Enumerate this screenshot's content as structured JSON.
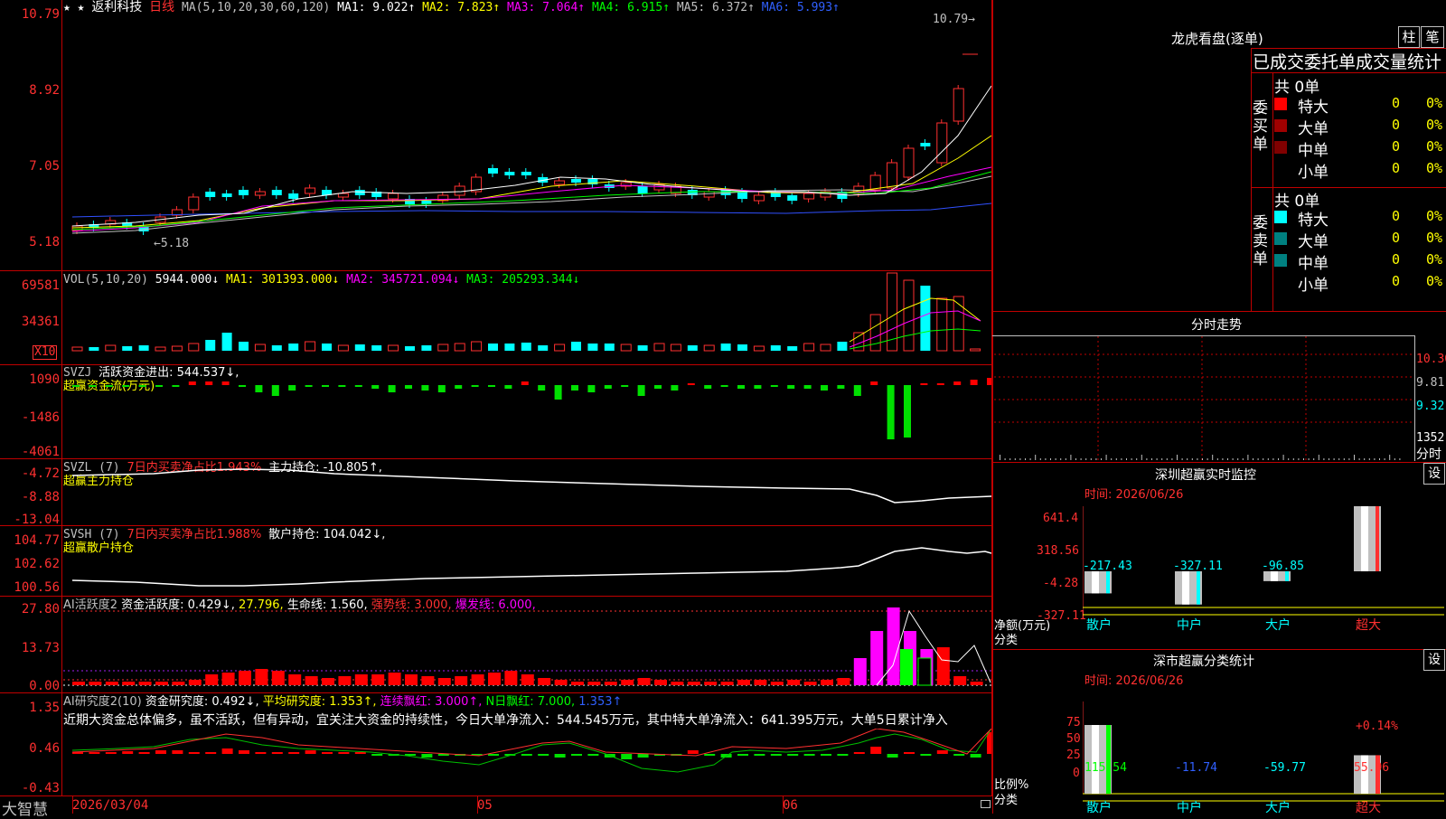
{
  "title_bar": {
    "stars": "★ ★",
    "stock": "返利科技",
    "period": "日线",
    "ma_label": "MA(5,10,20,30,60,120)",
    "ma1": "MA1: 9.022↑",
    "ma2": "MA2: 7.823↑",
    "ma3": "MA3: 7.064↑",
    "ma4": "MA4: 6.915↑",
    "ma5": "MA5: 6.372↑",
    "ma6": "MA6: 5.993↑"
  },
  "price_panel": {
    "axis": [
      "10.79",
      "8.92",
      "7.05",
      "5.18"
    ],
    "high_label": "10.79→",
    "low_label": "←5.18"
  },
  "vol_panel": {
    "label": "VOL(5,10,20)",
    "value": "5944.000↓",
    "ma1": "MA1: 301393.000↓",
    "ma2": "MA2: 345721.094↓",
    "ma3": "MA3: 205293.344↓",
    "axis": [
      "69581",
      "34361"
    ],
    "unit": "X10"
  },
  "svzj_panel": {
    "label": "SVZJ",
    "desc": "活跃资金进出: 544.537↓,",
    "name": "超赢资金流(万元)",
    "axis": [
      "1090",
      "-1486",
      "-4061"
    ]
  },
  "svzl_panel": {
    "label": "SVZL (7)",
    "desc1": "7日内买卖净占比1.943%",
    "desc2": "主力持仓: -10.805↑,",
    "name": "超赢主力持仓",
    "axis": [
      "-4.72",
      "-8.88",
      "-13.04"
    ]
  },
  "svsh_panel": {
    "label": "SVSH (7)",
    "desc1": "7日内买卖净占比1.988%",
    "desc2": "散户持仓: 104.042↓,",
    "name": "超赢散户持仓",
    "axis": [
      "104.77",
      "102.62",
      "100.56"
    ]
  },
  "ai_active": {
    "label": "AI活跃度2",
    "d1": "资金活跃度: 0.429↓,",
    "d2": "27.796,",
    "d3": "生命线: 1.560,",
    "d4": "强势线: 3.000,",
    "d5": "爆发线: 6.000,",
    "axis": [
      "27.80",
      "13.73",
      "0.00"
    ]
  },
  "ai_research": {
    "label": "AI研究度2(10)",
    "d1": "资金研究度: 0.492↓,",
    "d2": "平均研究度: 1.353↑,",
    "d3": "连续飘红: 3.000↑,",
    "d4": "N日飘红: 7.000,",
    "d5": "1.353↑",
    "comment": "近期大资金总体偏多，虽不活跃，但有异动，宜关注大资金的持续性，今日大单净流入：544.545万元，其中特大单净流入：641.395万元，大单5日累计净入",
    "axis": [
      "1.35",
      "0.46",
      "-0.43"
    ]
  },
  "bottom_bar": {
    "brand": "大智慧",
    "dates": [
      "2026/03/04",
      "05",
      "06"
    ]
  },
  "right_panel": {
    "lhb_title": "龙虎看盘(逐单)",
    "btn1": "柱",
    "btn2": "笔",
    "sub_title": "已成交委托单成交量统计",
    "buy": {
      "side": "委买单",
      "total": "共 0单",
      "rows": [
        {
          "name": "特大",
          "count": "0",
          "pct": "0%",
          "color": "#ff0000"
        },
        {
          "name": "大单",
          "count": "0",
          "pct": "0%",
          "color": "#a00000"
        },
        {
          "name": "中单",
          "count": "0",
          "pct": "0%",
          "color": "#800000"
        },
        {
          "name": "小单",
          "count": "0",
          "pct": "0%",
          "color": ""
        }
      ]
    },
    "sell": {
      "side": "委卖单",
      "total": "共 0单",
      "rows": [
        {
          "name": "特大",
          "count": "0",
          "pct": "0%",
          "color": "#00ffff"
        },
        {
          "name": "大单",
          "count": "0",
          "pct": "0%",
          "color": "#008080"
        },
        {
          "name": "中单",
          "count": "0",
          "pct": "0%",
          "color": "#008080"
        },
        {
          "name": "小单",
          "count": "0",
          "pct": "0%",
          "color": ""
        }
      ]
    },
    "fs_title": "分时走势",
    "fs_axis": [
      "10.30",
      "9.81",
      "9.32"
    ],
    "fs_vol": "1352",
    "fs_label": "分时",
    "monitor": {
      "title": "深圳超赢实时监控",
      "btn": "设",
      "date": "时间: 2026/06/26",
      "axis": [
        "641.4",
        "318.56",
        "-4.28",
        "-327.11"
      ],
      "ylabel": "净额(万元)",
      "xlabel": "分类",
      "bars": [
        {
          "cat": "散户",
          "value": "-217.43"
        },
        {
          "cat": "中户",
          "value": "-327.11"
        },
        {
          "cat": "大户",
          "value": "-96.85"
        },
        {
          "cat": "超大",
          "value": "641.4"
        }
      ]
    },
    "classify": {
      "title": "深市超赢分类统计",
      "btn": "设",
      "date": "时间: 2026/06/26",
      "axis": [
        "75",
        "50",
        "25",
        "0"
      ],
      "ylabel": "比例%",
      "xlabel": "分类",
      "annotation": "+0.14%",
      "bars": [
        {
          "cat": "散户",
          "value": "115.54"
        },
        {
          "cat": "中户",
          "value": "-11.74"
        },
        {
          "cat": "大户",
          "value": "-59.77"
        },
        {
          "cat": "超大",
          "value": "55.96"
        }
      ]
    }
  }
}
